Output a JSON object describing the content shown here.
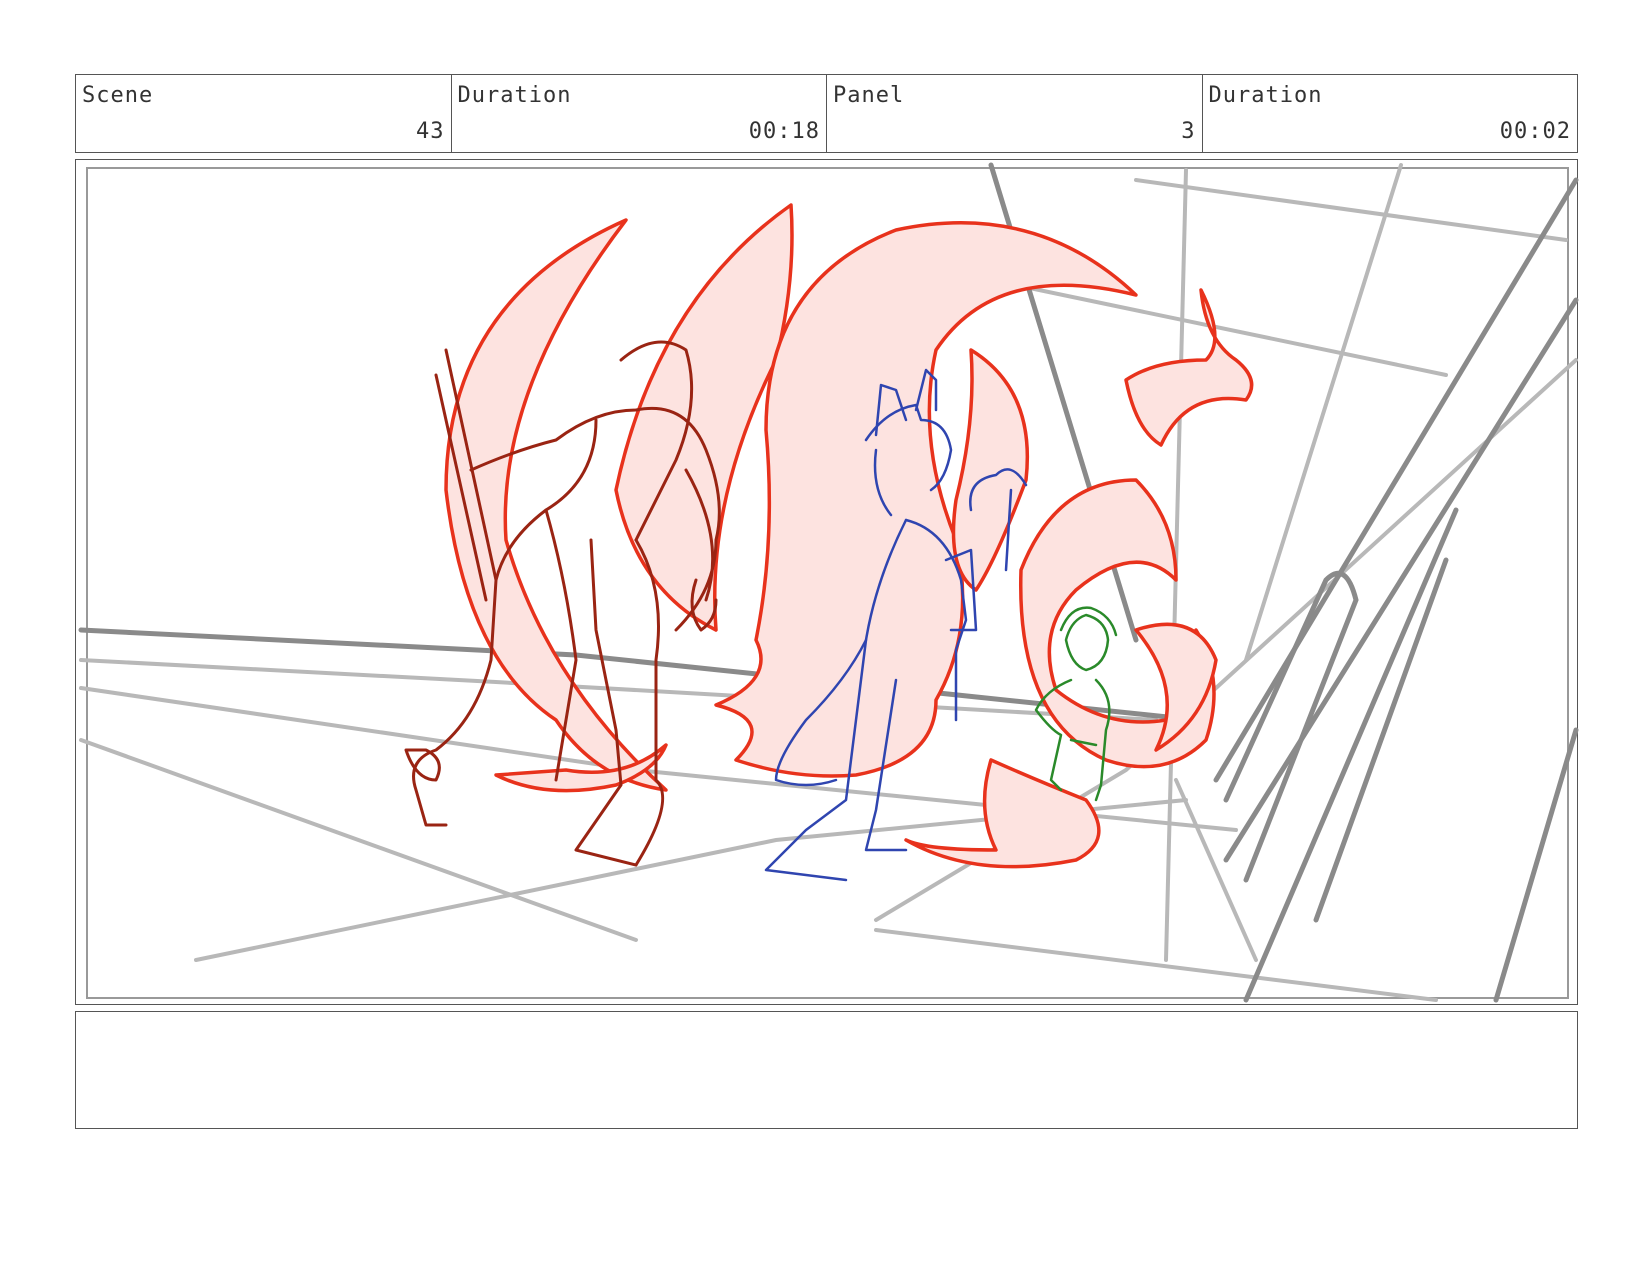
{
  "header": {
    "scene_label": "Scene",
    "scene_value": "43",
    "duration_label": "Duration",
    "duration_value": "00:18",
    "panel_label": "Panel",
    "panel_value": "3",
    "panel_duration_label": "Duration",
    "panel_duration_value": "00:02"
  },
  "colors": {
    "fire_stroke": "#e8321c",
    "fire_fill": "#fde3e0",
    "character_left": "#9a2413",
    "character_center": "#2f45b0",
    "character_right": "#2a8a2a",
    "layout_lines": "#9a9a9a"
  },
  "notes": {
    "text": ""
  }
}
